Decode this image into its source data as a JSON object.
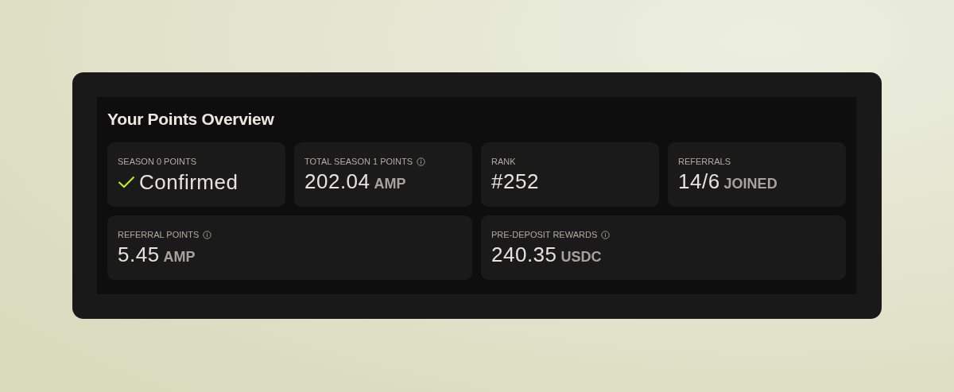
{
  "title": "Your Points Overview",
  "stats": [
    {
      "kind": "status",
      "label": "SEASON 0 POINTS",
      "info": false,
      "value": "Confirmed",
      "wide": false
    },
    {
      "kind": "number",
      "label": "TOTAL SEASON 1 POINTS",
      "info": true,
      "value": "202.04",
      "unit": "AMP",
      "wide": false
    },
    {
      "kind": "number",
      "label": "RANK",
      "info": false,
      "value": "#252",
      "wide": false
    },
    {
      "kind": "number",
      "label": "REFERRALS",
      "info": false,
      "value": "14/6",
      "unit": "JOINED",
      "wide": false
    },
    {
      "kind": "number",
      "label": "REFERRAL POINTS",
      "info": true,
      "value": "5.45",
      "unit": "AMP",
      "wide": true
    },
    {
      "kind": "number",
      "label": "PRE-DEPOSIT REWARDS",
      "info": true,
      "value": "240.35",
      "unit": "USDC",
      "wide": true
    }
  ]
}
